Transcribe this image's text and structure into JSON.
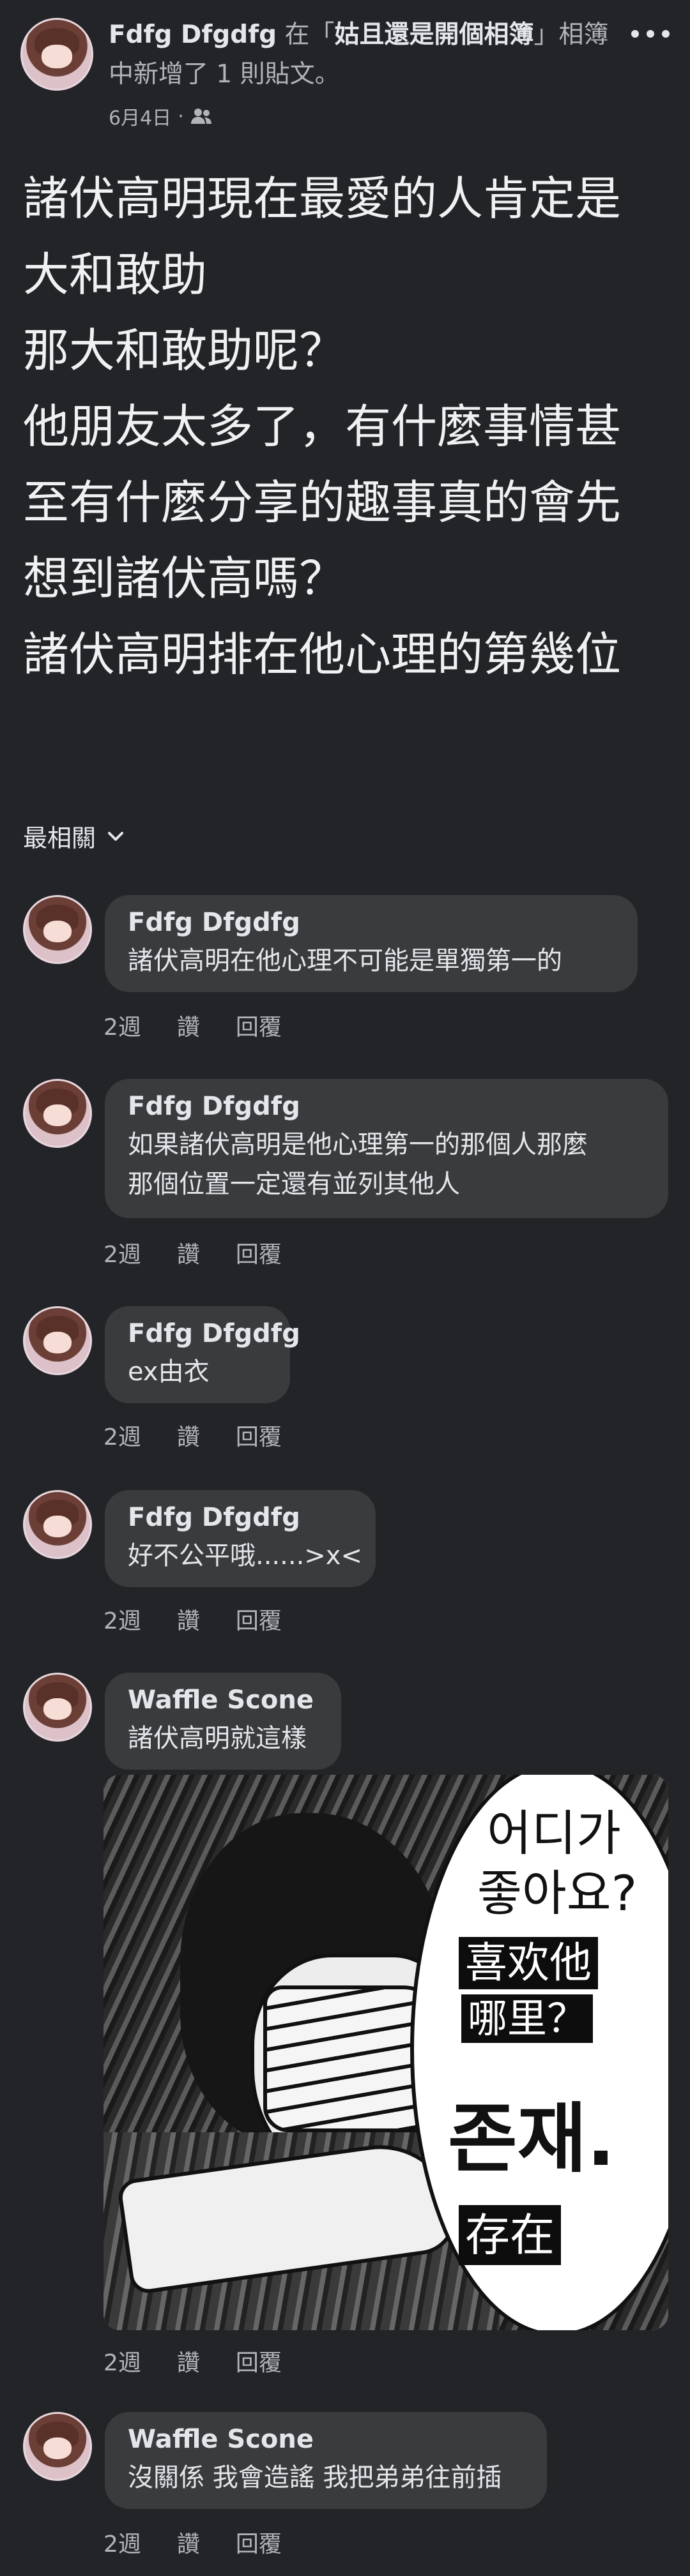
{
  "post": {
    "author": "Fdfg Dfgdfg",
    "action_prefix": "在「",
    "album": "姑且還是開個相簿",
    "action_suffix": "」相簿中新增了 1 則貼文。",
    "date": "6月4日",
    "separator": "·",
    "audience_icon": "friends-icon",
    "body_lines": [
      "諸伏高明現在最愛的人肯定是",
      "大和敢助",
      "那大和敢助呢？",
      "他朋友太多了，有什麼事情甚",
      "至有什麼分享的趣事真的會先",
      "想到諸伏高嗎？",
      "諸伏高明排在他心理的第幾位"
    ]
  },
  "sort": {
    "label": "最相關",
    "icon": "chevron-down-icon"
  },
  "comments": [
    {
      "name": "Fdfg Dfgdfg",
      "lines": [
        "諸伏高明在他心理不可能是單獨第一的"
      ],
      "time": "2週",
      "like": "讚",
      "reply": "回覆"
    },
    {
      "name": "Fdfg Dfgdfg",
      "lines": [
        "如果諸伏高明是他心理第一的那個人那麼",
        "那個位置一定還有並列其他人"
      ],
      "time": "2週",
      "like": "讚",
      "reply": "回覆"
    },
    {
      "name": "Fdfg Dfgdfg",
      "lines": [
        "ex由衣"
      ],
      "time": "2週",
      "like": "讚",
      "reply": "回覆"
    },
    {
      "name": "Fdfg Dfgdfg",
      "lines": [
        "好不公平哦......>x<"
      ],
      "time": "2週",
      "like": "讚",
      "reply": "回覆"
    },
    {
      "name": "Waffle Scone",
      "lines": [
        "諸伏高明就這樣"
      ],
      "time": "2週",
      "like": "讚",
      "reply": "回覆"
    },
    {
      "name": "Waffle Scone",
      "lines": [
        "沒關係 我會造謠 我把弟弟往前插"
      ],
      "time": "2週",
      "like": "讚",
      "reply": "回覆"
    }
  ],
  "meme": {
    "korean_line1": "어디가",
    "korean_line2": "좋아요?",
    "chinese_line1": "喜欢他",
    "chinese_line2": "哪里？",
    "korean_answer": "존재.",
    "chinese_answer": "存在"
  },
  "colors": {
    "background": "#232427",
    "bubble": "#3a3b3c",
    "text": "#e4e6eb",
    "muted": "#b0b3b8"
  }
}
